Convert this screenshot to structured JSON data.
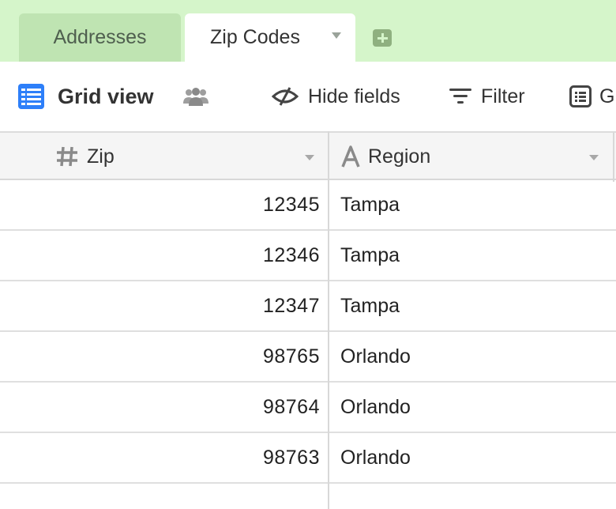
{
  "tabs": [
    {
      "label": "Addresses",
      "active": false
    },
    {
      "label": "Zip Codes",
      "active": true
    }
  ],
  "tab_icons": {
    "dropdown": "chevron-down-icon",
    "add": "add-tab-icon"
  },
  "toolbar": {
    "view_label": "Grid view",
    "view_icon": "grid-view-icon",
    "collaborators_icon": "people-icon",
    "hide_fields_label": "Hide fields",
    "filter_label": "Filter",
    "group_label": "G"
  },
  "table": {
    "columns": [
      {
        "name": "Zip",
        "type_icon": "number-icon"
      },
      {
        "name": "Region",
        "type_icon": "text-icon"
      }
    ],
    "rows": [
      {
        "zip": "12345",
        "region": "Tampa"
      },
      {
        "zip": "12346",
        "region": "Tampa"
      },
      {
        "zip": "12347",
        "region": "Tampa"
      },
      {
        "zip": "98765",
        "region": "Orlando"
      },
      {
        "zip": "98764",
        "region": "Orlando"
      },
      {
        "zip": "98763",
        "region": "Orlando"
      }
    ]
  },
  "colors": {
    "tabbar_bg": "#d5f5ca",
    "inactive_tab_bg": "#bfe4b2",
    "accent_blue": "#2d7ff9",
    "header_bg": "#f5f5f5"
  }
}
